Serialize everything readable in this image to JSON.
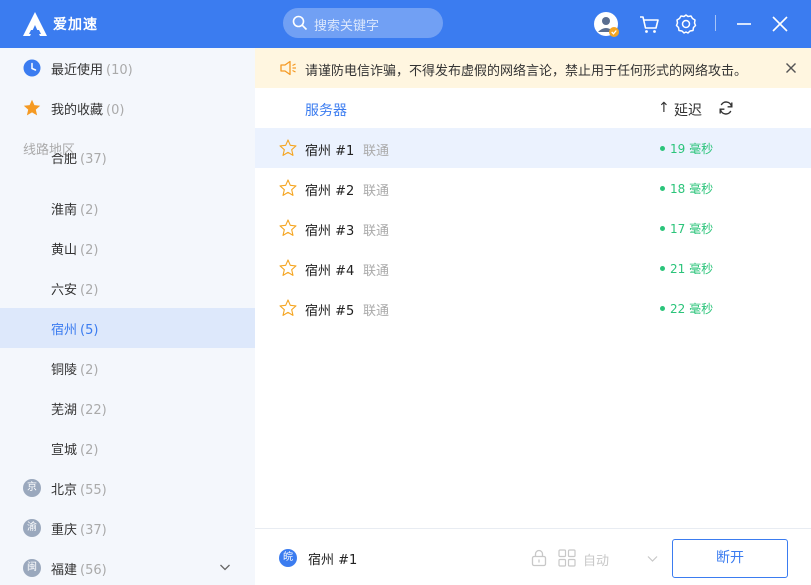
{
  "app": {
    "title": "爱加速",
    "accent": "#3b7cf0"
  },
  "search": {
    "placeholder": "搜索关键字"
  },
  "toolbar": {
    "icons": [
      "user-avatar-icon",
      "cart-icon",
      "gear-icon",
      "minimize-icon",
      "close-icon"
    ]
  },
  "sidebar": {
    "recent": {
      "label": "最近使用",
      "count": "(10)"
    },
    "favorites": {
      "label": "我的收藏",
      "count": "(0)"
    },
    "region_header": "线路地区",
    "cities": [
      {
        "label": "合肥",
        "count": "(37)"
      },
      {
        "label": "淮南",
        "count": "(2)"
      },
      {
        "label": "黄山",
        "count": "(2)"
      },
      {
        "label": "六安",
        "count": "(2)"
      },
      {
        "label": "宿州",
        "count": "(5)"
      },
      {
        "label": "铜陵",
        "count": "(2)"
      },
      {
        "label": "芜湖",
        "count": "(22)"
      },
      {
        "label": "宣城",
        "count": "(2)"
      }
    ],
    "provinces": [
      {
        "badge": "京",
        "label": "北京",
        "count": "(55)"
      },
      {
        "badge": "渝",
        "label": "重庆",
        "count": "(37)"
      },
      {
        "badge": "闽",
        "label": "福建",
        "count": "(56)"
      }
    ]
  },
  "notice": {
    "text": "请谨防电信诈骗，不得发布虚假的网络言论，禁止用于任何形式的网络攻击。"
  },
  "table": {
    "col_server": "服务器",
    "sort_arrow": "↑",
    "col_latency": "延迟",
    "rows": [
      {
        "name": "宿州 #1",
        "isp": "联通",
        "latency": "19 毫秒"
      },
      {
        "name": "宿州 #2",
        "isp": "联通",
        "latency": "18 毫秒"
      },
      {
        "name": "宿州 #3",
        "isp": "联通",
        "latency": "17 毫秒"
      },
      {
        "name": "宿州 #4",
        "isp": "联通",
        "latency": "21 毫秒"
      },
      {
        "name": "宿州 #5",
        "isp": "联通",
        "latency": "22 毫秒"
      }
    ]
  },
  "footer": {
    "badge": "皖",
    "server": "宿州 #1",
    "mode": "自动",
    "disconnect_label": "断开"
  }
}
